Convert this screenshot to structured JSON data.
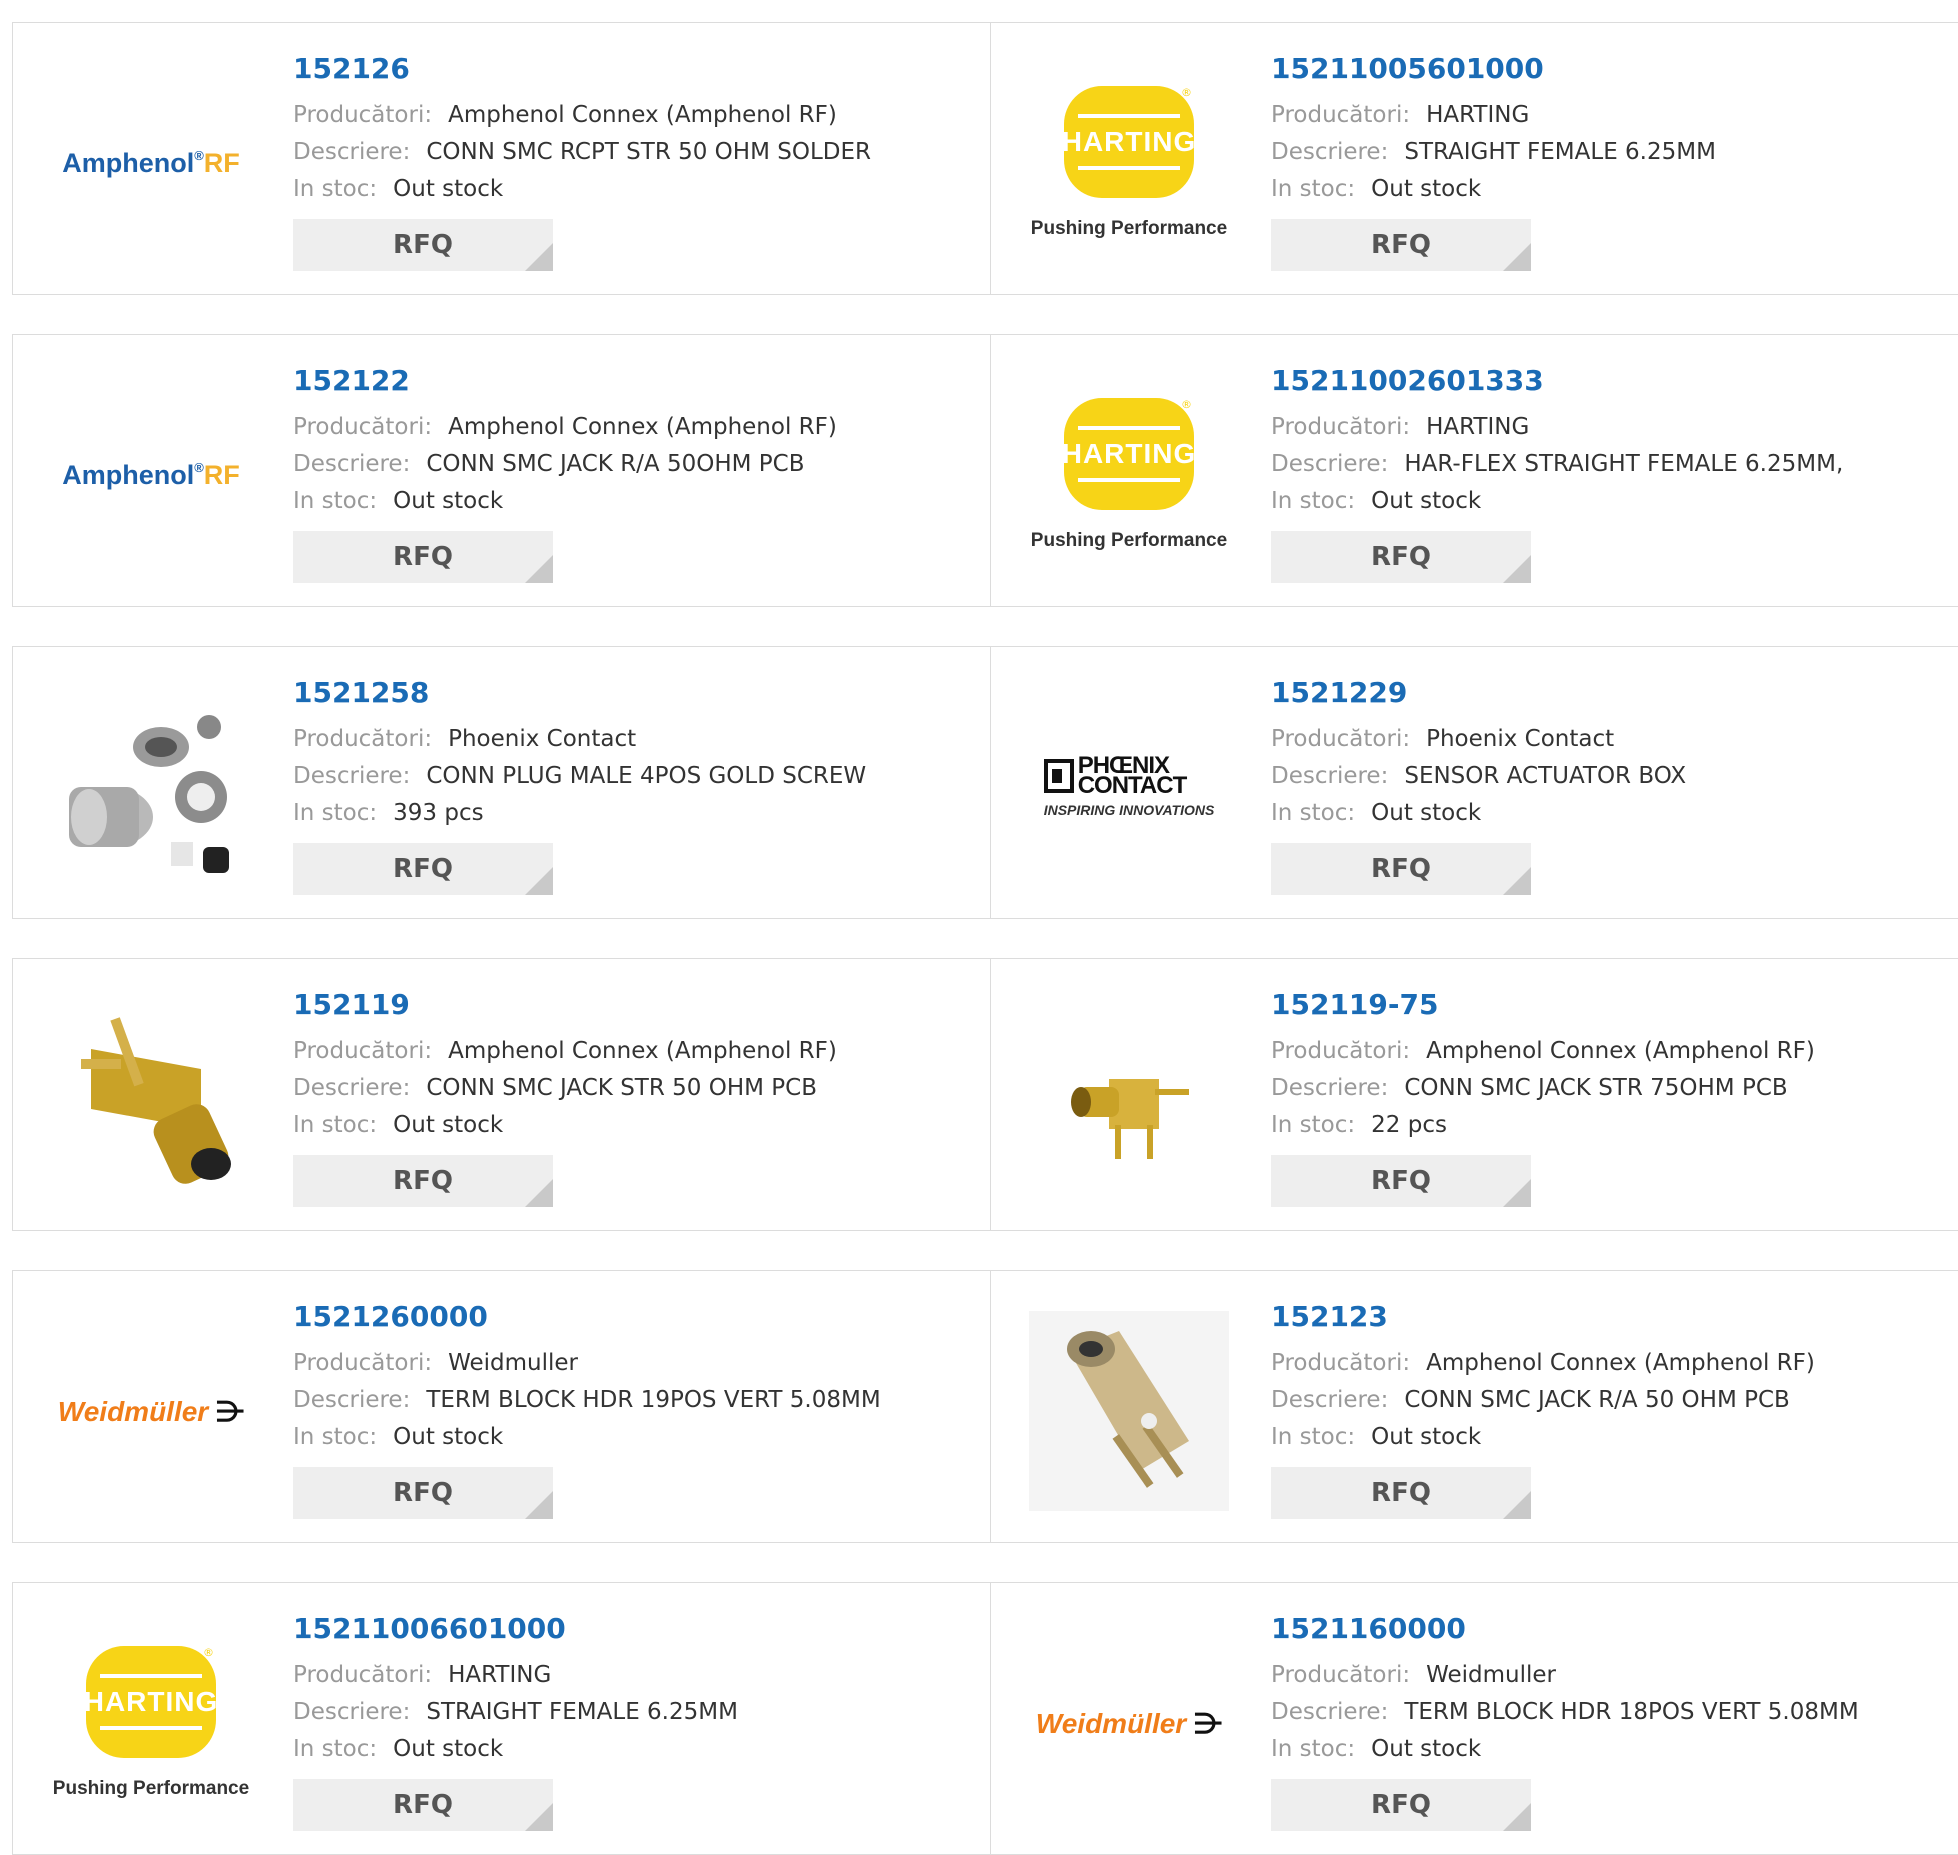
{
  "labels": {
    "manufacturer": "Producători:",
    "description": "Descriere:",
    "stock": "In stoc:",
    "rfq": "RFQ"
  },
  "logos": {
    "amphenol": {
      "main": "Amphenol",
      "reg": "®",
      "rf": "RF"
    },
    "harting": {
      "name": "HARTING",
      "tagline": "Pushing Performance",
      "reg": "®"
    },
    "phoenix": {
      "line1": "PHŒNIX",
      "line2": "CONTACT",
      "tagline": "INSPIRING INNOVATIONS"
    },
    "weidmuller": {
      "name": "Weidmüller",
      "mark": "⋺"
    }
  },
  "colors": {
    "link": "#1a6bb5",
    "harting_yellow": "#f7d417",
    "weid_orange": "#f07d19",
    "amph_blue": "#1d5fa8"
  },
  "products": [
    {
      "pn": "152126",
      "manufacturer": "Amphenol Connex (Amphenol RF)",
      "description": "CONN SMC RCPT STR 50 OHM SOLDER",
      "stock": "Out stock",
      "logo": "amphenol"
    },
    {
      "pn": "15211005601000",
      "manufacturer": "HARTING",
      "description": "STRAIGHT FEMALE 6.25MM",
      "stock": "Out stock",
      "logo": "harting"
    },
    {
      "pn": "152122",
      "manufacturer": "Amphenol Connex (Amphenol RF)",
      "description": "CONN SMC JACK R/A 50OHM PCB",
      "stock": "Out stock",
      "logo": "amphenol"
    },
    {
      "pn": "15211002601333",
      "manufacturer": "HARTING",
      "description": "HAR-FLEX STRAIGHT FEMALE 6.25MM,",
      "stock": "Out stock",
      "logo": "harting"
    },
    {
      "pn": "1521258",
      "manufacturer": "Phoenix Contact",
      "description": "CONN PLUG MALE 4POS GOLD SCREW",
      "stock": "393 pcs",
      "logo": "photo-plug"
    },
    {
      "pn": "1521229",
      "manufacturer": "Phoenix Contact",
      "description": "SENSOR ACTUATOR BOX",
      "stock": "Out stock",
      "logo": "phoenix"
    },
    {
      "pn": "152119",
      "manufacturer": "Amphenol Connex (Amphenol RF)",
      "description": "CONN SMC JACK STR 50 OHM PCB",
      "stock": "Out stock",
      "logo": "photo-smc-gold"
    },
    {
      "pn": "152119-75",
      "manufacturer": "Amphenol Connex (Amphenol RF)",
      "description": "CONN SMC JACK STR 75OHM PCB",
      "stock": "22 pcs",
      "logo": "photo-smc-small"
    },
    {
      "pn": "1521260000",
      "manufacturer": "Weidmuller",
      "description": "TERM BLOCK HDR 19POS VERT 5.08MM",
      "stock": "Out stock",
      "logo": "weidmuller"
    },
    {
      "pn": "152123",
      "manufacturer": "Amphenol Connex (Amphenol RF)",
      "description": "CONN SMC JACK R/A 50 OHM PCB",
      "stock": "Out stock",
      "logo": "photo-smc-ra"
    },
    {
      "pn": "15211006601000",
      "manufacturer": "HARTING",
      "description": "STRAIGHT FEMALE 6.25MM",
      "stock": "Out stock",
      "logo": "harting"
    },
    {
      "pn": "1521160000",
      "manufacturer": "Weidmuller",
      "description": "TERM BLOCK HDR 18POS VERT 5.08MM",
      "stock": "Out stock",
      "logo": "weidmuller"
    }
  ]
}
